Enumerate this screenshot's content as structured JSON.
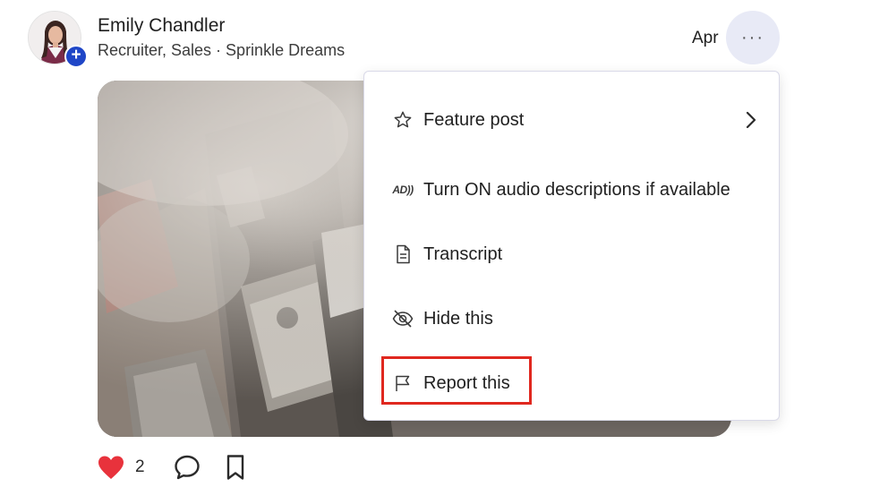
{
  "post": {
    "author_name": "Emily Chandler",
    "author_meta": "Recruiter, Sales · Sprinkle Dreams",
    "date": "Apr",
    "follow_symbol": "+",
    "more_symbol": "···"
  },
  "actions": {
    "like_count": "2"
  },
  "menu": {
    "items": [
      {
        "label": "Feature post",
        "icon": "star-icon",
        "has_submenu": true
      },
      {
        "label": "Turn ON audio descriptions if available",
        "icon": "audio-description-icon",
        "icon_text": "AD))"
      },
      {
        "label": "Transcript",
        "icon": "document-icon"
      },
      {
        "label": "Hide this",
        "icon": "eye-slash-icon"
      },
      {
        "label": "Report this",
        "icon": "flag-icon",
        "highlighted": true
      }
    ]
  },
  "colors": {
    "accent_blue": "#1f46c7",
    "more_button_bg": "#e8eaf6",
    "heart_red": "#e8323c",
    "highlight_red": "#e0281f"
  }
}
